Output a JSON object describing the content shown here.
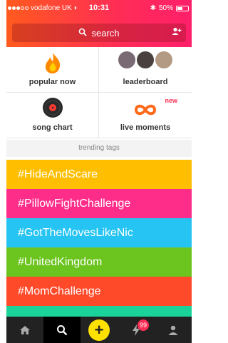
{
  "status_bar": {
    "carrier": "vodafone UK",
    "time": "10:31",
    "battery": "50%"
  },
  "search": {
    "placeholder": "search"
  },
  "tiles": [
    {
      "label": "popular now",
      "icon": "flame-icon"
    },
    {
      "label": "leaderboard",
      "icon": "avatars-icon"
    },
    {
      "label": "song chart",
      "icon": "vinyl-icon"
    },
    {
      "label": "live moments",
      "icon": "infinity-icon",
      "badge": "new"
    }
  ],
  "trending_title": "trending tags",
  "tags": [
    {
      "text": "#HideAndScare",
      "color": "#ffbf00"
    },
    {
      "text": "#PillowFightChallenge",
      "color": "#ff2d8a"
    },
    {
      "text": "#GotTheMovesLikeNic",
      "color": "#25c4f3"
    },
    {
      "text": "#UnitedKingdom",
      "color": "#6cc41f"
    },
    {
      "text": "#MomChallenge",
      "color": "#ff4a2a"
    }
  ],
  "tabbar": {
    "notification_count": "99",
    "add_label": "+"
  },
  "colors": {
    "header_start": "#ff5a1e",
    "header_end": "#ff1f6b",
    "accent": "#ff2d55",
    "teal_peek": "#1ad39a"
  }
}
